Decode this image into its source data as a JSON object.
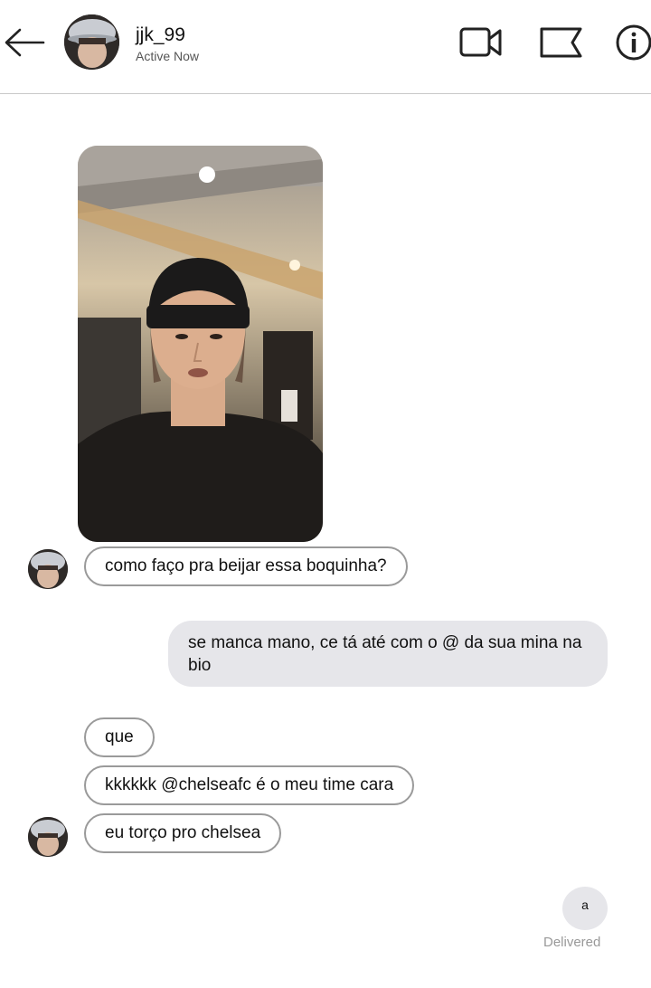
{
  "header": {
    "username": "jjk_99",
    "status": "Active Now",
    "icons": [
      "back-arrow-icon",
      "video-call-icon",
      "flag-icon",
      "info-icon"
    ]
  },
  "messages": {
    "incoming_1": "como faço pra beijar essa boquinha?",
    "outgoing_1": "se manca mano, ce tá até com o @ da sua mina na bio",
    "incoming_2": "que",
    "incoming_3": "kkkkkk @chelseafc é o meu time cara",
    "incoming_4": "eu torço pro chelsea",
    "outgoing_2": "a"
  },
  "footer": {
    "delivered": "Delivered"
  },
  "colors": {
    "incoming_border": "#9a9a9a",
    "outgoing_bg": "#e6e6ea",
    "delivered_text": "#999999"
  }
}
